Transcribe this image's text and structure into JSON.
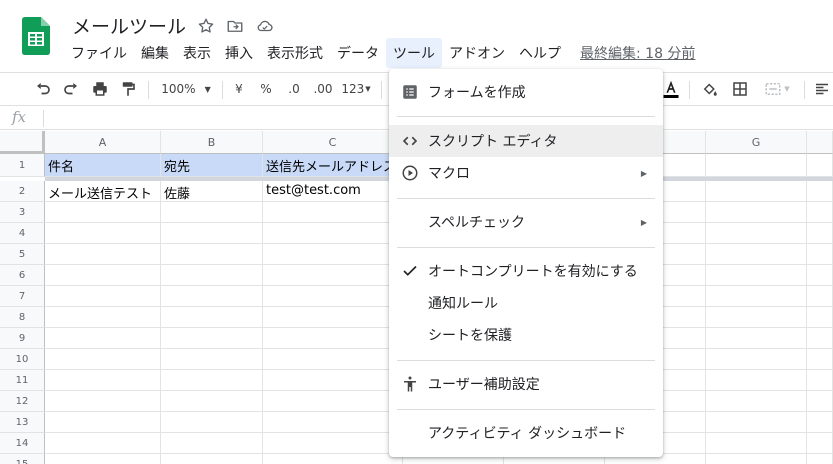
{
  "doc": {
    "title": "メールツール",
    "last_edit": "最終編集: 18 分前"
  },
  "menubar": [
    "ファイル",
    "編集",
    "表示",
    "挿入",
    "表示形式",
    "データ",
    "ツール",
    "アドオン",
    "ヘルプ"
  ],
  "toolbar": {
    "zoom": "100%",
    "currency": "¥",
    "percent": "%",
    "dec_less": ".0",
    "dec_more": ".00",
    "format_more": "123"
  },
  "formula_bar": {
    "fx": "fx",
    "value": ""
  },
  "columns": [
    "A",
    "B",
    "C",
    "G"
  ],
  "rows": [
    "1",
    "2",
    "3",
    "4",
    "5",
    "6",
    "7",
    "8",
    "9",
    "10",
    "11",
    "12",
    "13",
    "14",
    "15"
  ],
  "cells": {
    "a1": "件名",
    "b1": "宛先",
    "c1": "送信先メールアドレス",
    "a2": "メール送信テスト",
    "b2": "佐藤",
    "c2": "test@test.com"
  },
  "tools_menu": {
    "create_form": "フォームを作成",
    "script_editor": "スクリプト エディタ",
    "macros": "マクロ",
    "spelling": "スペルチェック",
    "autocomplete": "オートコンプリートを有効にする",
    "notification_rules": "通知ルール",
    "protect_sheet": "シートを保護",
    "accessibility": "ユーザー補助設定",
    "activity_dashboard": "アクティビティ ダッシュボード"
  },
  "colors": {
    "accent_green": "#0f9d58",
    "header_fill": "#c9daf8",
    "menu_active": "#e8f0fe"
  }
}
